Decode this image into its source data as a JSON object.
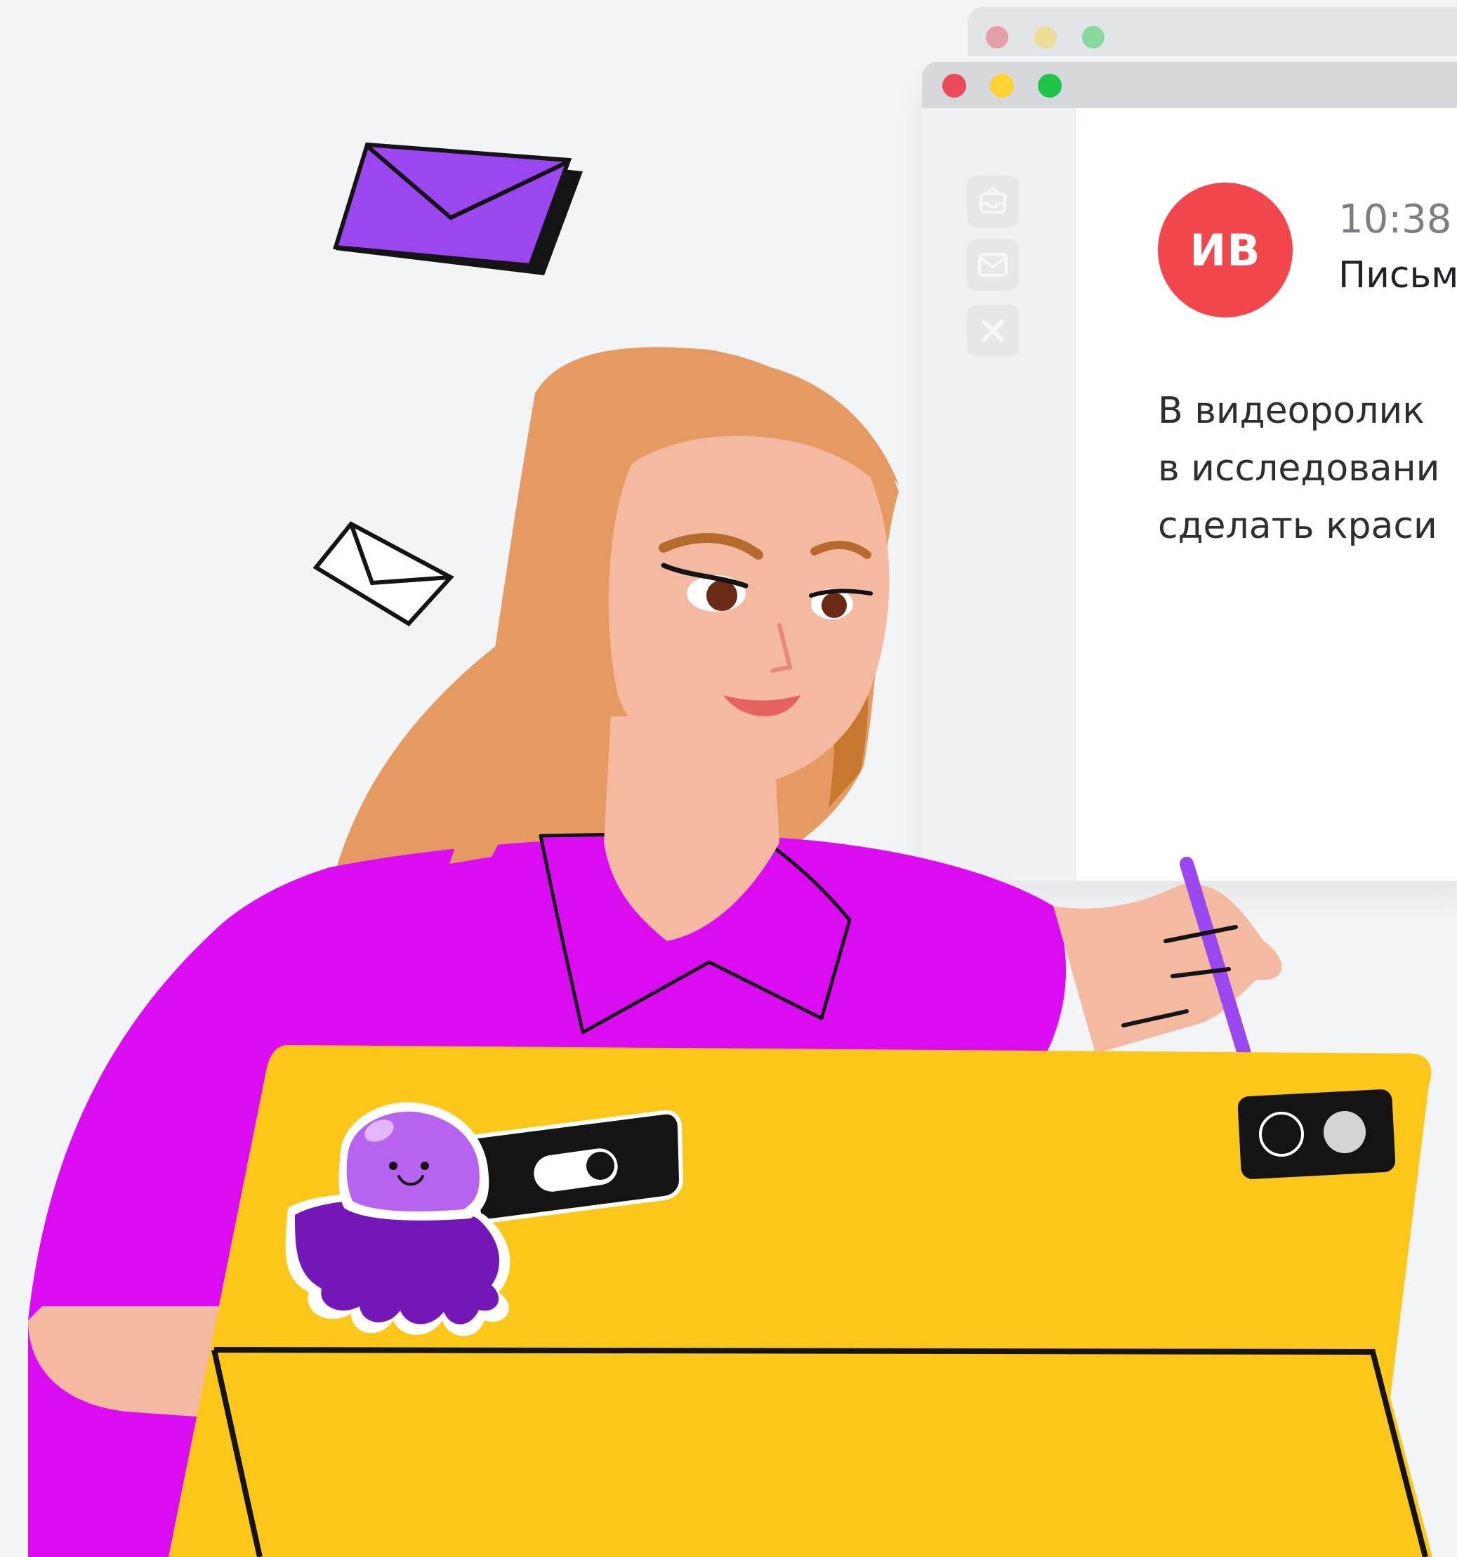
{
  "window": {
    "traffic_lights": {
      "close": "#ea4a5a",
      "minimize": "#fdd232",
      "maximize": "#1fc548"
    },
    "sidebar_icons": [
      "inbox-icon",
      "mail-icon",
      "close-icon"
    ]
  },
  "message": {
    "avatar_initials": "ИВ",
    "avatar_color": "#f2464c",
    "time": "10:38",
    "subject": "Письм",
    "body_lines": [
      "В видеоролик",
      "в исследовани",
      "сделать краси"
    ]
  },
  "illustration": {
    "colors": {
      "envelope": "#9b47f0",
      "shirt": "#db0cf2",
      "hair": "#e49a61",
      "skin": "#f4b9a1",
      "tablet": "#fdc71a"
    },
    "icons": [
      "envelope-icon",
      "envelope-outline-icon",
      "octopus-sticker-icon",
      "toggle-icon",
      "camera-icon"
    ]
  }
}
